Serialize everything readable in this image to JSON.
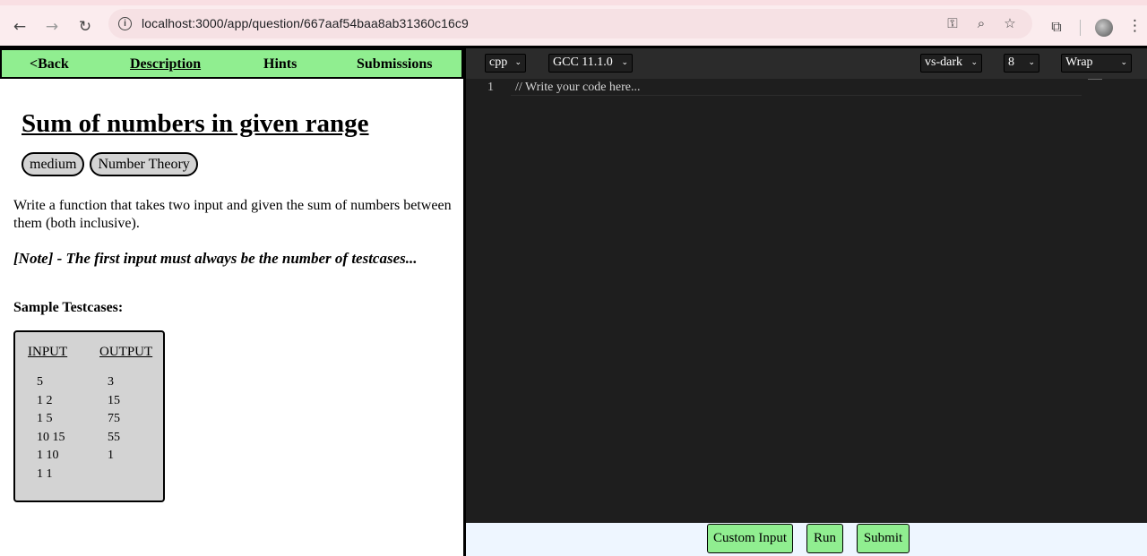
{
  "browser": {
    "url": "localhost:3000/app/question/667aaf54baa8ab31360c16c9",
    "back_icon": "←",
    "forward_icon": "→",
    "reload_icon": "↻",
    "info_icon": "i",
    "key_icon": "⚿",
    "zoom_icon": "⌕",
    "star_icon": "☆",
    "extensions_icon": "⧉",
    "menu_icon": "⋮"
  },
  "tabs": {
    "back": "<Back",
    "description": "Description",
    "hints": "Hints",
    "submissions": "Submissions"
  },
  "question": {
    "title": "Sum of numbers in given range",
    "tags": [
      "medium",
      "Number Theory"
    ],
    "description": "Write a function that takes two input and given the sum of numbers between them (both inclusive).",
    "note": "[Note] - The first input must always be the number of testcases...",
    "sample_heading": "Sample Testcases:"
  },
  "testcases": {
    "input_header": "INPUT",
    "output_header": "OUTPUT",
    "inputs": [
      "5",
      "1 2",
      "1 5",
      "10 15",
      "1 10",
      "1 1"
    ],
    "outputs": [
      "3",
      "15",
      "75",
      "55",
      "1"
    ]
  },
  "editor": {
    "language": "cpp",
    "compiler": "GCC 11.1.0",
    "theme": "vs-dark",
    "font_size": "8",
    "wrap": "Wrap",
    "chevron": "⌄",
    "line_number": "1",
    "code": "// Write your code here..."
  },
  "actions": {
    "custom_input": "Custom Input",
    "run": "Run",
    "submit": "Submit"
  },
  "colors": {
    "tab_bar": "#90ee90",
    "editor_bg": "#1e1e1e",
    "tag_bg": "#d3d3d3",
    "bottom_bar": "#eef6ff"
  }
}
